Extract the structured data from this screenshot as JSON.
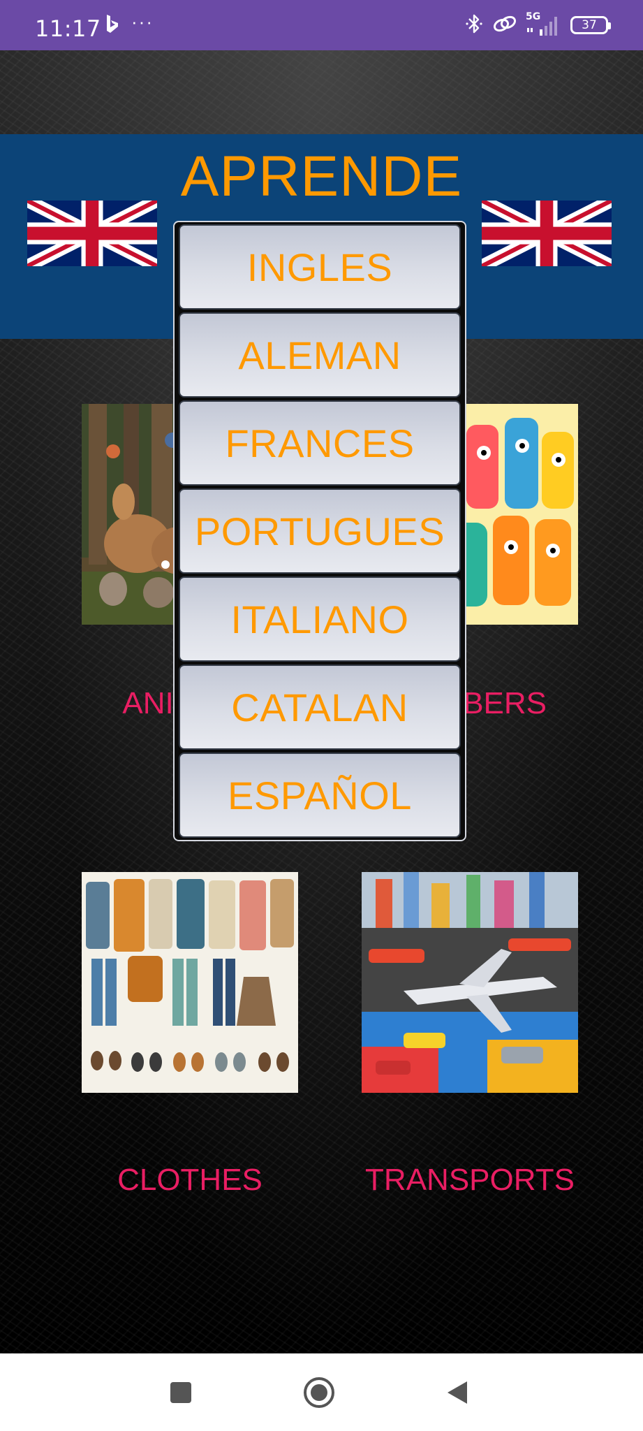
{
  "status_bar": {
    "time": "11:17",
    "network": "5G",
    "battery": "37",
    "more": "···"
  },
  "header": {
    "title": "APRENDE"
  },
  "dropdown": {
    "options": [
      "INGLES",
      "ALEMAN",
      "FRANCES",
      "PORTUGUES",
      "ITALIANO",
      "CATALAN",
      "ESPAÑOL"
    ]
  },
  "categories": [
    {
      "label": "ANIMALS"
    },
    {
      "label": "NUMBERS"
    },
    {
      "label": "CLOTHES"
    },
    {
      "label": "TRANSPORTS"
    }
  ],
  "colors": {
    "status_bar": "#6b4aa6",
    "header_band": "#0c4478",
    "title": "#ff9900",
    "option_text": "#ff9900",
    "category_label": "#e91e63"
  },
  "icons": {
    "status_left": [
      "bing-icon",
      "more-icon"
    ],
    "status_right": [
      "bluetooth-icon",
      "link-icon",
      "signal-icon",
      "battery-icon"
    ],
    "navigation": [
      "recents-square-icon",
      "home-circle-icon",
      "back-triangle-icon"
    ]
  }
}
